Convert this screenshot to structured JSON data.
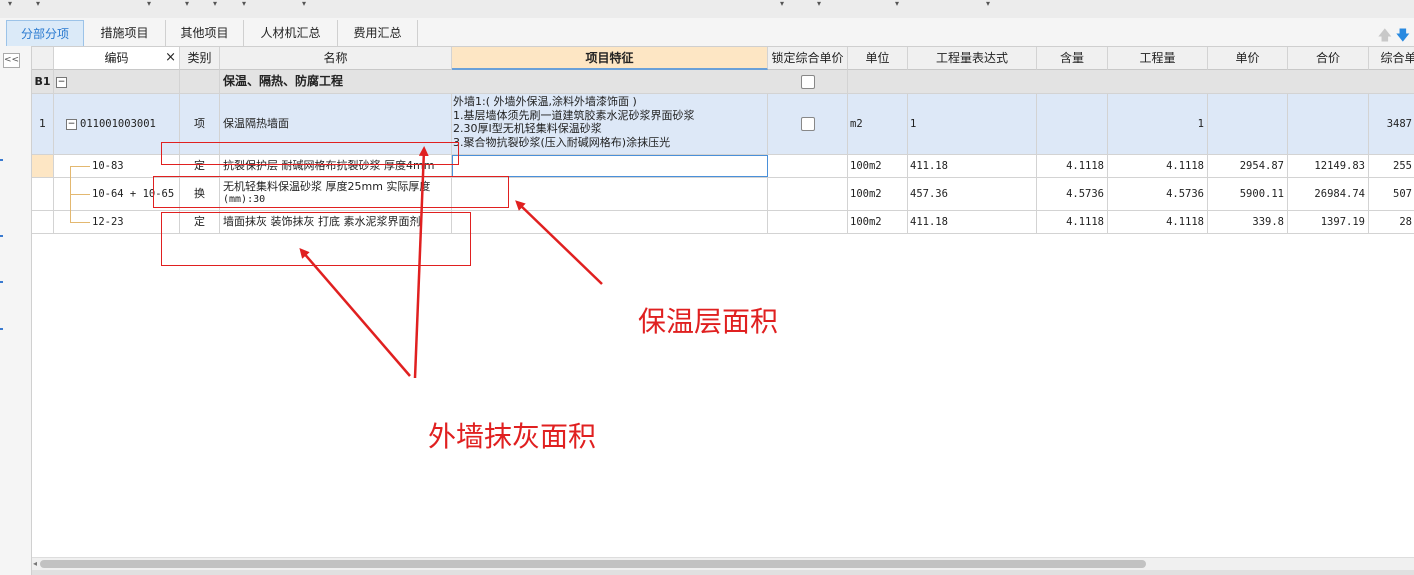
{
  "tabs": [
    {
      "label": "分部分项",
      "active": true
    },
    {
      "label": "措施项目",
      "active": false
    },
    {
      "label": "其他项目",
      "active": false
    },
    {
      "label": "人材机汇总",
      "active": false
    },
    {
      "label": "费用汇总",
      "active": false
    }
  ],
  "sidebar": {
    "collapse_label": "<<"
  },
  "columns": {
    "code": "编码",
    "code_close": "×",
    "category": "类别",
    "name": "名称",
    "features": "项目特征",
    "lock": "锁定综合单价",
    "unit": "单位",
    "expr": "工程量表达式",
    "content": "含量",
    "quantity": "工程量",
    "price": "单价",
    "total": "合价",
    "comp": "综合单"
  },
  "section_row": {
    "index": "B1",
    "name": "保温、隔热、防腐工程"
  },
  "item_row": {
    "index": "1",
    "code": "011001003001",
    "category": "项",
    "name": "保温隔热墙面",
    "features": [
      "外墙1:( 外墙外保温,涂料外墙漆饰面 )",
      "1.基层墙体须先刷一道建筑胶素水泥砂浆界面砂浆",
      "2.30厚Ⅰ型无机轻集料保温砂浆",
      "3.聚合物抗裂砂浆(压入耐碱网格布)涂抹压光"
    ],
    "unit": "m2",
    "expr": "1",
    "quantity": "1",
    "comp": "3487"
  },
  "sub_rows": [
    {
      "code": "10-83",
      "category": "定",
      "name": "抗裂保护层 耐碱网格布抗裂砂浆 厚度4mm",
      "unit": "100m2",
      "expr": "411.18",
      "content": "4.1118",
      "quantity": "4.1118",
      "price": "2954.87",
      "total": "12149.83",
      "comp": "255"
    },
    {
      "code": "10-64 + 10-65",
      "category": "换",
      "name": "无机轻集料保温砂浆 厚度25mm  实际厚度",
      "name2": "(mm):30",
      "unit": "100m2",
      "expr": "457.36",
      "content": "4.5736",
      "quantity": "4.5736",
      "price": "5900.11",
      "total": "26984.74",
      "comp": "507"
    },
    {
      "code": "12-23",
      "category": "定",
      "name": "墙面抹灰 装饰抹灰 打底 素水泥浆界面剂",
      "unit": "100m2",
      "expr": "411.18",
      "content": "4.1118",
      "quantity": "4.1118",
      "price": "339.8",
      "total": "1397.19",
      "comp": "28"
    }
  ],
  "annotations": {
    "insulation_area": "保温层面积",
    "plaster_area": "外墙抹灰面积"
  },
  "colors": {
    "annotation": "#e02020",
    "active_tab": "#2a7ad0",
    "selected_header": "#fde6c4",
    "item_row_bg": "#dde8f7",
    "section_row_bg": "#e3e3e3"
  }
}
